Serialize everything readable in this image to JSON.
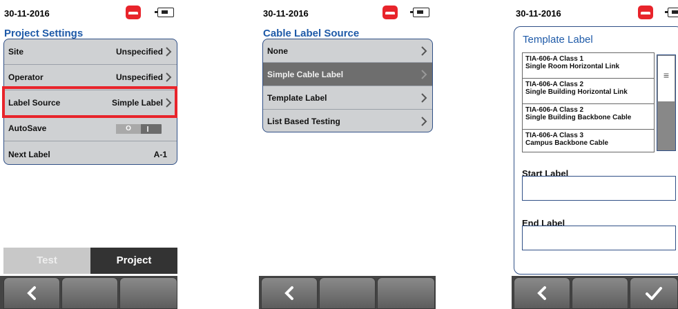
{
  "screen1": {
    "date": "30-11-2016",
    "title": "Project Settings",
    "rows": [
      {
        "label": "Site",
        "value": "Unspecified"
      },
      {
        "label": "Operator",
        "value": "Unspecified"
      },
      {
        "label": "Label Source",
        "value": "Simple Label"
      },
      {
        "label": "AutoSave",
        "toggle_text": "O",
        "toggle_state": "off"
      },
      {
        "label": "Next Label",
        "value": "A-1"
      }
    ],
    "tabs": {
      "inactive": "Test",
      "active": "Project"
    }
  },
  "screen2": {
    "date": "30-11-2016",
    "title": "Cable Label Source",
    "rows": [
      {
        "label": "None"
      },
      {
        "label": "Simple Cable Label",
        "selected": true
      },
      {
        "label": "Template Label"
      },
      {
        "label": "List Based Testing"
      }
    ]
  },
  "screen3": {
    "date": "30-11-2016",
    "title": "Template Label",
    "templates": [
      {
        "line1": "TIA-606-A Class 1",
        "line2": "Single Room Horizontal Link"
      },
      {
        "line1": "TIA-606-A Class 2",
        "line2": "Single Building Horizontal Link"
      },
      {
        "line1": "TIA-606-A Class 2",
        "line2": "Single Building Backbone Cable"
      },
      {
        "line1": "TIA-606-A Class 3",
        "line2": "Campus Backbone Cable"
      }
    ],
    "start_label": "Start Label",
    "end_label": "End Label"
  },
  "colors": {
    "accent": "#1e5aa8",
    "alert": "#e8242b",
    "row_bg": "#cfd1d3",
    "selected_row": "#6e6e6e"
  },
  "icons": {
    "call": "phone-hangup-icon",
    "power": "battery-icon",
    "back": "chevron-left-icon",
    "confirm": "checkmark-icon",
    "row": "chevron-right-icon"
  }
}
